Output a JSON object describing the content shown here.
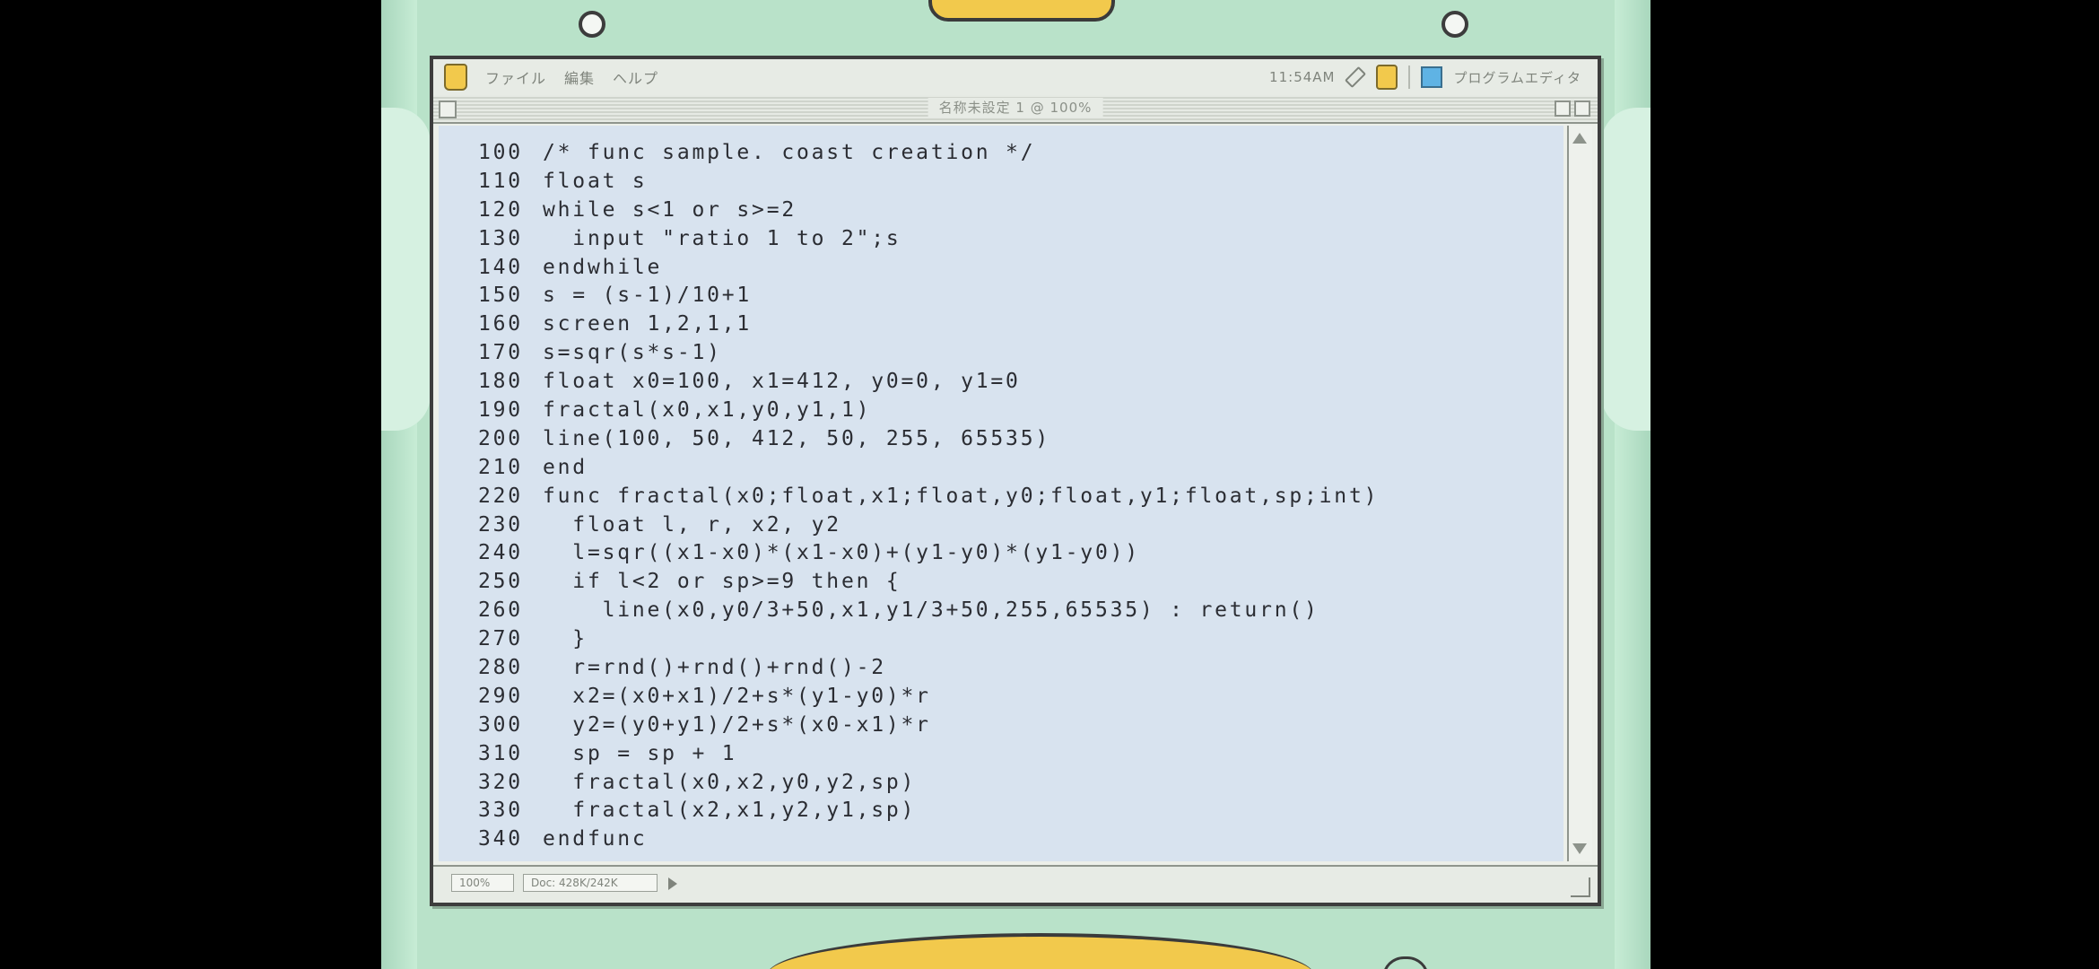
{
  "menubar": {
    "items": [
      "ファイル",
      "編集",
      "ヘルプ"
    ],
    "clock": "11:54AM",
    "app_name": "プログラムエディタ"
  },
  "window": {
    "title": "名称未設定 1 @ 100%"
  },
  "code": {
    "lines": [
      {
        "num": "100",
        "text": "/* func sample. coast creation */"
      },
      {
        "num": "110",
        "text": "float s"
      },
      {
        "num": "120",
        "text": "while s<1 or s>=2"
      },
      {
        "num": "130",
        "text": "  input \"ratio 1 to 2\";s"
      },
      {
        "num": "140",
        "text": "endwhile"
      },
      {
        "num": "150",
        "text": "s = (s-1)/10+1"
      },
      {
        "num": "160",
        "text": "screen 1,2,1,1"
      },
      {
        "num": "170",
        "text": "s=sqr(s*s-1)"
      },
      {
        "num": "180",
        "text": "float x0=100, x1=412, y0=0, y1=0"
      },
      {
        "num": "190",
        "text": "fractal(x0,x1,y0,y1,1)"
      },
      {
        "num": "200",
        "text": "line(100, 50, 412, 50, 255, 65535)"
      },
      {
        "num": "210",
        "text": "end"
      },
      {
        "num": "220",
        "text": "func fractal(x0;float,x1;float,y0;float,y1;float,sp;int)"
      },
      {
        "num": "230",
        "text": "  float l, r, x2, y2"
      },
      {
        "num": "240",
        "text": "  l=sqr((x1-x0)*(x1-x0)+(y1-y0)*(y1-y0))"
      },
      {
        "num": "250",
        "text": "  if l<2 or sp>=9 then {"
      },
      {
        "num": "260",
        "text": "    line(x0,y0/3+50,x1,y1/3+50,255,65535) : return()"
      },
      {
        "num": "270",
        "text": "  }"
      },
      {
        "num": "280",
        "text": "  r=rnd()+rnd()+rnd()-2"
      },
      {
        "num": "290",
        "text": "  x2=(x0+x1)/2+s*(y1-y0)*r"
      },
      {
        "num": "300",
        "text": "  y2=(y0+y1)/2+s*(x0-x1)*r"
      },
      {
        "num": "310",
        "text": "  sp = sp + 1"
      },
      {
        "num": "320",
        "text": "  fractal(x0,x2,y0,y2,sp)"
      },
      {
        "num": "330",
        "text": "  fractal(x2,x1,y2,y1,sp)"
      },
      {
        "num": "340",
        "text": "endfunc"
      }
    ]
  },
  "statusbar": {
    "zoom": "100%",
    "doc": "Doc: 428K/242K"
  }
}
